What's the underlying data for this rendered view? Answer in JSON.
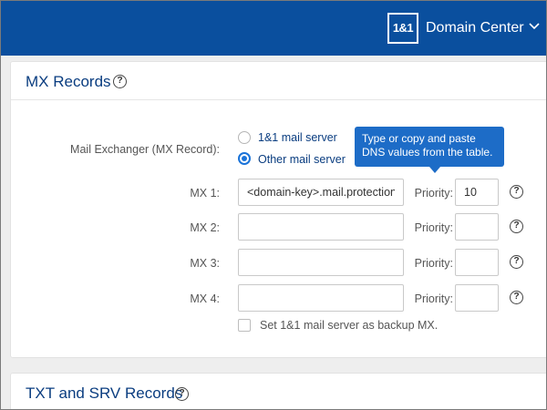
{
  "header": {
    "logo_text": "1&1",
    "title": "Domain Center",
    "chevron_icon": "chevron-down-icon",
    "background_color": "#0a4f9e"
  },
  "mx_section": {
    "title": "MX Records",
    "help_glyph": "?",
    "mail_exchanger_label": "Mail Exchanger (MX Record):",
    "radio_options": [
      {
        "label": "1&1 mail server",
        "checked": false
      },
      {
        "label": "Other mail server",
        "checked": true
      }
    ],
    "tooltip_text": "Type or copy and paste DNS values from the table.",
    "priority_label": "Priority:",
    "records": [
      {
        "label": "MX 1:",
        "host": "<domain-key>.mail.protection.outlook.com",
        "priority": "10"
      },
      {
        "label": "MX 2:",
        "host": "",
        "priority": ""
      },
      {
        "label": "MX 3:",
        "host": "",
        "priority": ""
      },
      {
        "label": "MX 4:",
        "host": "",
        "priority": ""
      }
    ],
    "backup_checkbox_label": "Set 1&1 mail server as backup MX.",
    "backup_checked": false
  },
  "txt_section": {
    "title": "TXT and SRV Records",
    "help_glyph": "?"
  },
  "colors": {
    "accent": "#1a73d9",
    "title_color": "#0a3d80"
  }
}
